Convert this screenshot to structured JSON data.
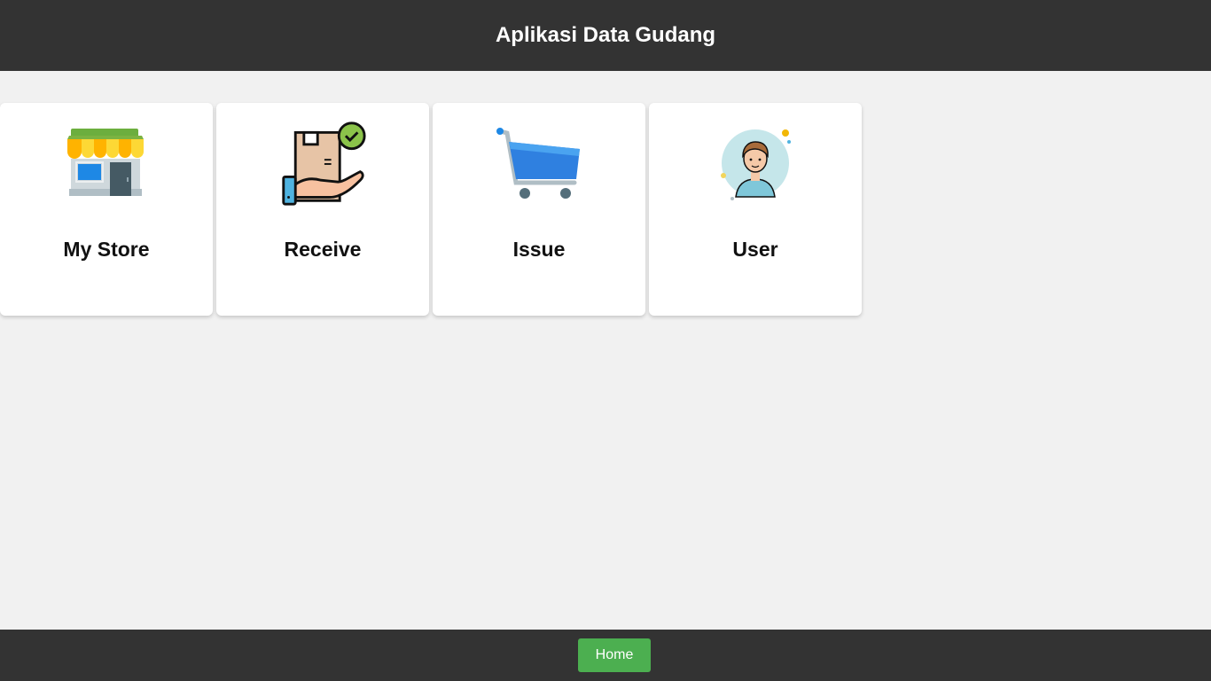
{
  "header": {
    "title": "Aplikasi Data Gudang"
  },
  "menu": {
    "items": [
      {
        "label": "My Store",
        "icon": "store-icon"
      },
      {
        "label": "Receive",
        "icon": "receive-box-icon"
      },
      {
        "label": "Issue",
        "icon": "shopping-cart-icon"
      },
      {
        "label": "User",
        "icon": "user-avatar-icon"
      }
    ]
  },
  "footer": {
    "home_label": "Home",
    "home_color": "#4caf50"
  },
  "colors": {
    "bar": "#333333",
    "background": "#f1f1f1",
    "card": "#ffffff"
  }
}
